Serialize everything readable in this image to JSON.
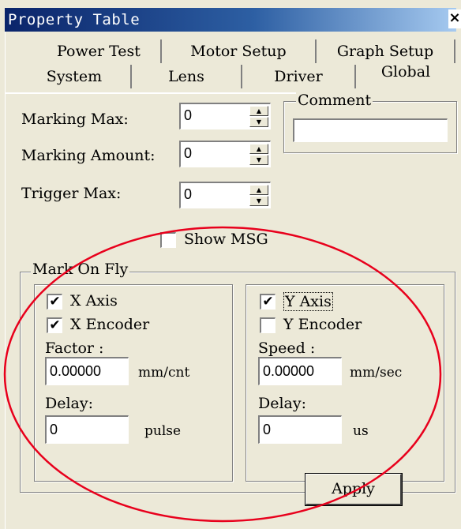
{
  "window": {
    "title": "Property Table",
    "close": "×"
  },
  "tabs": {
    "row1": [
      "Power Test",
      "Motor Setup",
      "Graph Setup"
    ],
    "row2": [
      "System",
      "Lens",
      "Driver",
      "Global"
    ]
  },
  "fields": {
    "marking_max": {
      "label": "Marking Max:",
      "value": "0"
    },
    "marking_amount": {
      "label": "Marking Amount:",
      "value": "0"
    },
    "trigger_max": {
      "label": "Trigger Max:",
      "value": "0"
    }
  },
  "comment": {
    "legend": "Comment",
    "value": ""
  },
  "show_msg": {
    "label": "Show MSG",
    "checked": false
  },
  "mark_on_fly": {
    "legend": "Mark On Fly",
    "left": {
      "x_axis": {
        "label": "X Axis",
        "check": "✔"
      },
      "x_encoder": {
        "label": "X Encoder",
        "check": "✔"
      },
      "factor_label": "Factor :",
      "factor_value": "0.00000",
      "factor_unit": "mm/cnt",
      "delay_label": "Delay:",
      "delay_value": "0",
      "delay_unit": "pulse"
    },
    "right": {
      "y_axis": {
        "label": "Y Axis",
        "check": "✔"
      },
      "y_encoder": {
        "label": "Y Encoder",
        "check": ""
      },
      "speed_label": "Speed :",
      "speed_value": "0.00000",
      "speed_unit": "mm/sec",
      "delay_label": "Delay:",
      "delay_value": "0",
      "delay_unit": "us"
    }
  },
  "apply": {
    "label": "Apply"
  },
  "annotation": {
    "color": "#e8001c"
  }
}
